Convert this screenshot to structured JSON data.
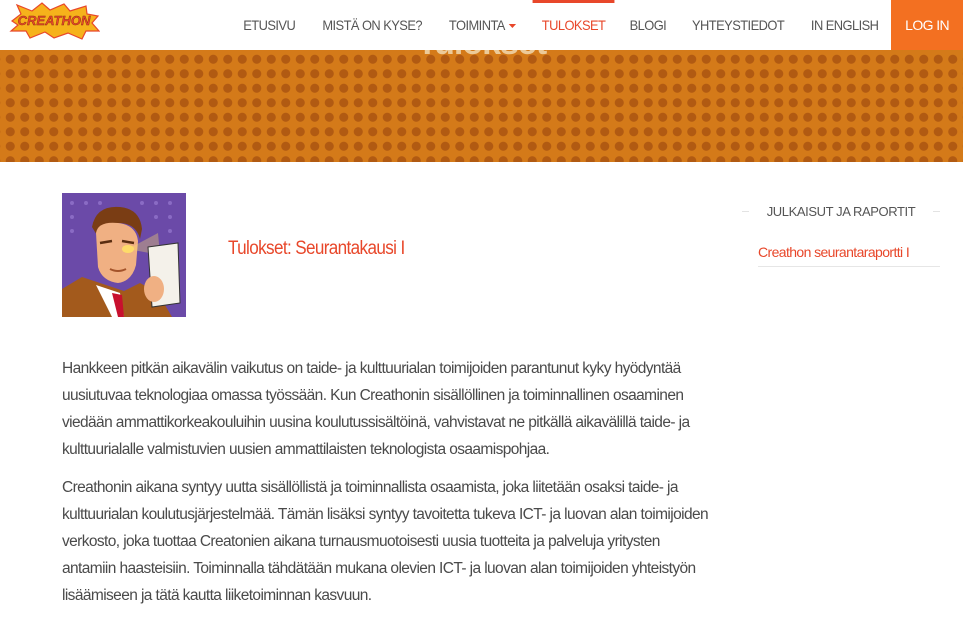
{
  "brand": {
    "logo_text": "CREATHON"
  },
  "nav": {
    "items": [
      {
        "label": "ETUSIVU"
      },
      {
        "label": "MISTÄ ON KYSE?"
      },
      {
        "label": "TOIMINTA"
      },
      {
        "label": "TULOKSET"
      },
      {
        "label": "BLOGI"
      },
      {
        "label": "YHTEYSTIEDOT"
      },
      {
        "label": "IN ENGLISH"
      }
    ],
    "login": "LOG IN"
  },
  "banner": {
    "title": "Tulokset"
  },
  "post": {
    "title": "Tulokset: Seurantakausi I",
    "paragraphs": [
      "Hankkeen pitkän aikavälin vaikutus on taide- ja kulttuurialan toimijoiden parantunut kyky hyödyntää uusiutuvaa teknologiaa omassa työssään. Kun Creathonin sisällöllinen ja toiminnallinen osaaminen viedään ammattikorkeakouluihin uusina koulutussisältöinä, vahvistavat ne pitkällä aikavälillä taide- ja kulttuurialalle valmistuvien uusien ammattilaisten teknologista osaamispohjaa.",
      "Creathonin aikana syntyy uutta sisällöllistä ja toiminnallista osaamista, joka liitetään osaksi taide- ja kulttuurialan koulutusjärjestelmää. Tämän lisäksi syntyy tavoitetta tukeva ICT- ja luovan alan toimijoiden verkosto, joka tuottaa Creatonien aikana turnausmuotoisesti uusia tuotteita ja palveluja yritysten antamiin haasteisiin. Toiminnalla tähdätään mukana olevien ICT- ja luovan alan toimijoiden yhteistyön lisäämiseen ja tätä kautta liiketoiminnan kasvuun."
    ]
  },
  "sidebar": {
    "widget_title": "JULKAISUT JA RAPORTIT",
    "links": [
      {
        "label": "Creathon seurantaraportti I"
      }
    ]
  },
  "colors": {
    "accent": "#e8472a",
    "login_bg": "#f37021",
    "banner": "#d47a19"
  }
}
